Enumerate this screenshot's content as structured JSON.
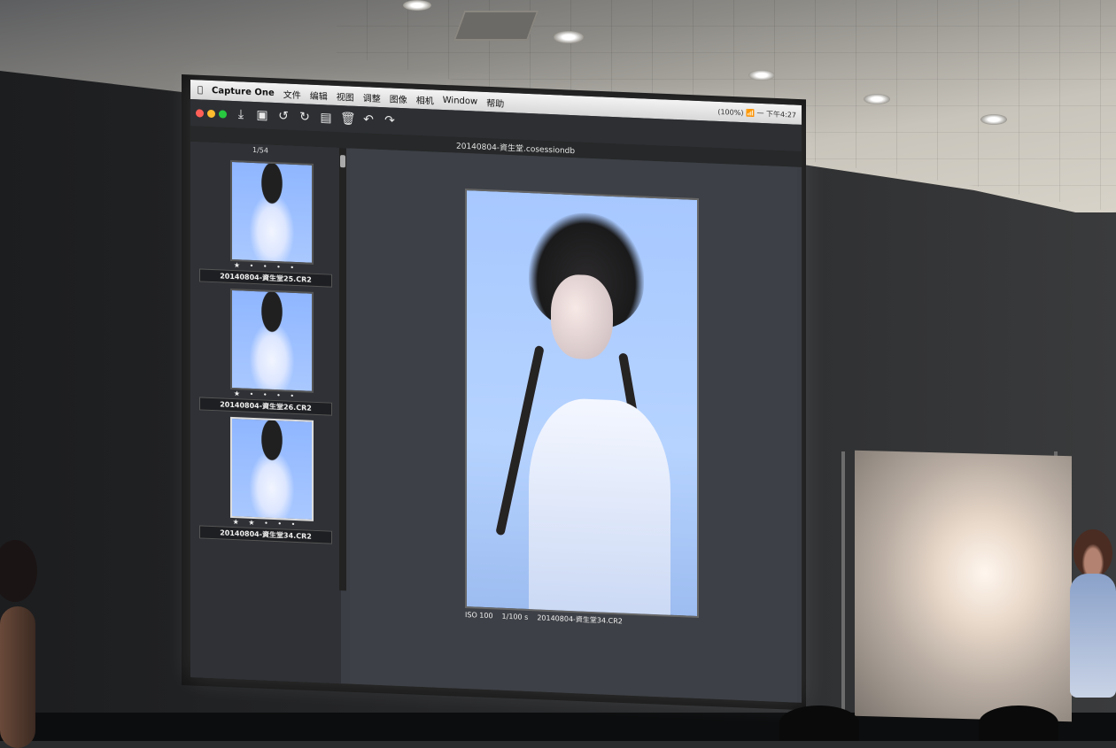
{
  "screen": {
    "app_name": "Capture One",
    "menu_items": [
      "文件",
      "编辑",
      "视图",
      "调整",
      "图像",
      "相机",
      "Window",
      "帮助"
    ],
    "status_right": "(100%)  📶  一 下午4:27",
    "session_file": "20140804-資生堂.cosessiondb",
    "browser_count": "1/54",
    "thumbnails": [
      {
        "name": "20140804-資生堂25.CR2",
        "selected": false
      },
      {
        "name": "20140804-資生堂26.CR2",
        "selected": false
      },
      {
        "name": "20140804-資生堂34.CR2",
        "selected": true
      }
    ],
    "viewer": {
      "iso": "ISO 100",
      "shutter": "1/100 s",
      "filename": "20140804-資生堂34.CR2"
    },
    "toolbar_icons": [
      "import-icon",
      "camera-icon",
      "rotate-left-icon",
      "rotate-right-icon",
      "folder-icon",
      "trash-icon",
      "undo-icon",
      "redo-icon"
    ],
    "traffic_colors": [
      "#ff5f57",
      "#febc2e",
      "#28c840"
    ]
  }
}
